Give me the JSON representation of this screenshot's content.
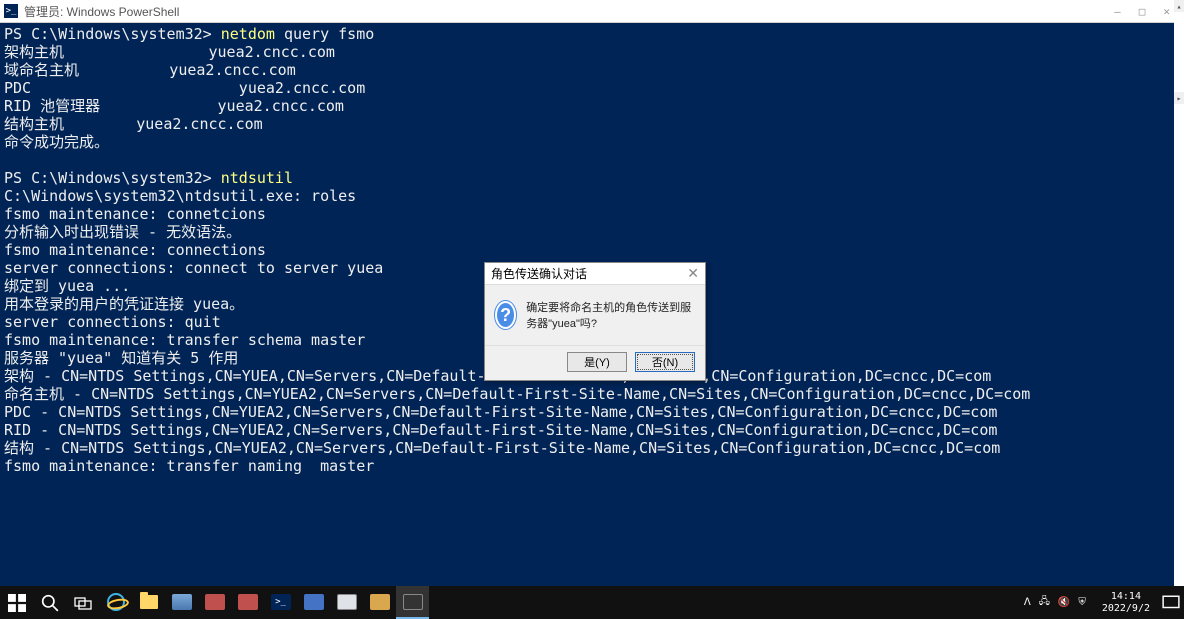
{
  "window": {
    "title": "管理员: Windows PowerShell"
  },
  "terminal": {
    "prompt1": "PS C:\\Windows\\system32> ",
    "cmd1a": "netdom",
    "cmd1b": " query fsmo",
    "lines1": "架构主机                yuea2.cncc.com\n域命名主机          yuea2.cncc.com\nPDC                       yuea2.cncc.com\nRID 池管理器             yuea2.cncc.com\n结构主机        yuea2.cncc.com\n命令成功完成。\n",
    "prompt2": "PS C:\\Windows\\system32> ",
    "cmd2": "ntdsutil",
    "lines2": "C:\\Windows\\system32\\ntdsutil.exe: roles\nfsmo maintenance: connetcions\n分析输入时出现错误 - 无效语法。\nfsmo maintenance: connections\nserver connections: connect to server yuea\n绑定到 yuea ...\n用本登录的用户的凭证连接 yuea。\nserver connections: quit\nfsmo maintenance: transfer schema master\n服务器 \"yuea\" 知道有关 5 作用\n架构 - CN=NTDS Settings,CN=YUEA,CN=Servers,CN=Default-First-Site-Name,CN=Sites,CN=Configuration,DC=cncc,DC=com\n命名主机 - CN=NTDS Settings,CN=YUEA2,CN=Servers,CN=Default-First-Site-Name,CN=Sites,CN=Configuration,DC=cncc,DC=com\nPDC - CN=NTDS Settings,CN=YUEA2,CN=Servers,CN=Default-First-Site-Name,CN=Sites,CN=Configuration,DC=cncc,DC=com\nRID - CN=NTDS Settings,CN=YUEA2,CN=Servers,CN=Default-First-Site-Name,CN=Sites,CN=Configuration,DC=cncc,DC=com\n结构 - CN=NTDS Settings,CN=YUEA2,CN=Servers,CN=Default-First-Site-Name,CN=Sites,CN=Configuration,DC=cncc,DC=com\nfsmo maintenance: transfer naming  master"
  },
  "dialog": {
    "title": "角色传送确认对话",
    "message": "确定要将命名主机的角色传送到服务器\"yuea\"吗?",
    "yes": "是(Y)",
    "no": "否(N)"
  },
  "taskbar": {
    "time": "14:14",
    "date": "2022/9/2"
  }
}
